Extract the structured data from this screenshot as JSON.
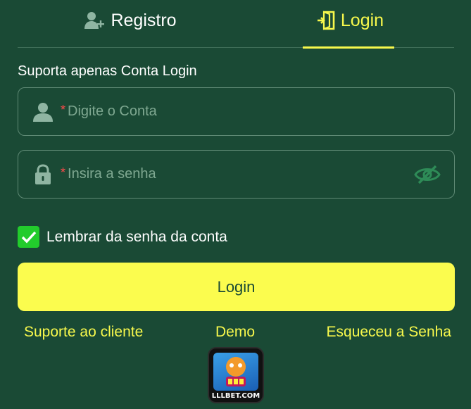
{
  "tabs": {
    "register_label": "Registro",
    "login_label": "Login",
    "active": "login"
  },
  "form": {
    "hint": "Suporta apenas Conta Login",
    "account_placeholder": "Digite o Conta",
    "password_placeholder": "Insira a senha",
    "required_mark": "*",
    "remember_label": "Lembrar da senha da conta",
    "remember_checked": true,
    "submit_label": "Login"
  },
  "links": {
    "support": "Suporte ao cliente",
    "demo": "Demo",
    "forgot": "Esqueceu a Senha"
  },
  "logo": {
    "brand_text": "LLLBET.COM"
  },
  "icons": {
    "register": "user-plus-icon",
    "login": "login-door-icon",
    "account": "user-icon",
    "password": "lock-icon",
    "toggle_password": "eye-off-icon",
    "checkbox": "checkmark-icon"
  },
  "colors": {
    "background": "#1a4a35",
    "accent": "#f7f84c",
    "button": "#fbfc4e",
    "checkbox": "#22cc2c",
    "required": "#ff4a4a",
    "placeholder": "#7fa891",
    "field_border": "#5f8a75"
  }
}
